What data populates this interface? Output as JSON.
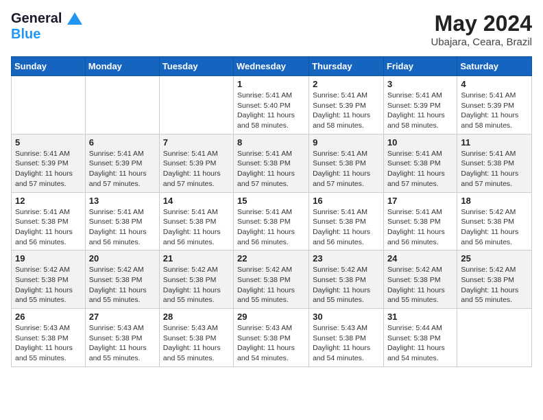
{
  "logo": {
    "line1": "General",
    "line2": "Blue"
  },
  "header": {
    "month_year": "May 2024",
    "location": "Ubajara, Ceara, Brazil"
  },
  "days_of_week": [
    "Sunday",
    "Monday",
    "Tuesday",
    "Wednesday",
    "Thursday",
    "Friday",
    "Saturday"
  ],
  "weeks": [
    [
      {
        "day": "",
        "info": ""
      },
      {
        "day": "",
        "info": ""
      },
      {
        "day": "",
        "info": ""
      },
      {
        "day": "1",
        "info": "Sunrise: 5:41 AM\nSunset: 5:40 PM\nDaylight: 11 hours and 58 minutes."
      },
      {
        "day": "2",
        "info": "Sunrise: 5:41 AM\nSunset: 5:39 PM\nDaylight: 11 hours and 58 minutes."
      },
      {
        "day": "3",
        "info": "Sunrise: 5:41 AM\nSunset: 5:39 PM\nDaylight: 11 hours and 58 minutes."
      },
      {
        "day": "4",
        "info": "Sunrise: 5:41 AM\nSunset: 5:39 PM\nDaylight: 11 hours and 58 minutes."
      }
    ],
    [
      {
        "day": "5",
        "info": "Sunrise: 5:41 AM\nSunset: 5:39 PM\nDaylight: 11 hours and 57 minutes."
      },
      {
        "day": "6",
        "info": "Sunrise: 5:41 AM\nSunset: 5:39 PM\nDaylight: 11 hours and 57 minutes."
      },
      {
        "day": "7",
        "info": "Sunrise: 5:41 AM\nSunset: 5:39 PM\nDaylight: 11 hours and 57 minutes."
      },
      {
        "day": "8",
        "info": "Sunrise: 5:41 AM\nSunset: 5:38 PM\nDaylight: 11 hours and 57 minutes."
      },
      {
        "day": "9",
        "info": "Sunrise: 5:41 AM\nSunset: 5:38 PM\nDaylight: 11 hours and 57 minutes."
      },
      {
        "day": "10",
        "info": "Sunrise: 5:41 AM\nSunset: 5:38 PM\nDaylight: 11 hours and 57 minutes."
      },
      {
        "day": "11",
        "info": "Sunrise: 5:41 AM\nSunset: 5:38 PM\nDaylight: 11 hours and 57 minutes."
      }
    ],
    [
      {
        "day": "12",
        "info": "Sunrise: 5:41 AM\nSunset: 5:38 PM\nDaylight: 11 hours and 56 minutes."
      },
      {
        "day": "13",
        "info": "Sunrise: 5:41 AM\nSunset: 5:38 PM\nDaylight: 11 hours and 56 minutes."
      },
      {
        "day": "14",
        "info": "Sunrise: 5:41 AM\nSunset: 5:38 PM\nDaylight: 11 hours and 56 minutes."
      },
      {
        "day": "15",
        "info": "Sunrise: 5:41 AM\nSunset: 5:38 PM\nDaylight: 11 hours and 56 minutes."
      },
      {
        "day": "16",
        "info": "Sunrise: 5:41 AM\nSunset: 5:38 PM\nDaylight: 11 hours and 56 minutes."
      },
      {
        "day": "17",
        "info": "Sunrise: 5:41 AM\nSunset: 5:38 PM\nDaylight: 11 hours and 56 minutes."
      },
      {
        "day": "18",
        "info": "Sunrise: 5:42 AM\nSunset: 5:38 PM\nDaylight: 11 hours and 56 minutes."
      }
    ],
    [
      {
        "day": "19",
        "info": "Sunrise: 5:42 AM\nSunset: 5:38 PM\nDaylight: 11 hours and 55 minutes."
      },
      {
        "day": "20",
        "info": "Sunrise: 5:42 AM\nSunset: 5:38 PM\nDaylight: 11 hours and 55 minutes."
      },
      {
        "day": "21",
        "info": "Sunrise: 5:42 AM\nSunset: 5:38 PM\nDaylight: 11 hours and 55 minutes."
      },
      {
        "day": "22",
        "info": "Sunrise: 5:42 AM\nSunset: 5:38 PM\nDaylight: 11 hours and 55 minutes."
      },
      {
        "day": "23",
        "info": "Sunrise: 5:42 AM\nSunset: 5:38 PM\nDaylight: 11 hours and 55 minutes."
      },
      {
        "day": "24",
        "info": "Sunrise: 5:42 AM\nSunset: 5:38 PM\nDaylight: 11 hours and 55 minutes."
      },
      {
        "day": "25",
        "info": "Sunrise: 5:42 AM\nSunset: 5:38 PM\nDaylight: 11 hours and 55 minutes."
      }
    ],
    [
      {
        "day": "26",
        "info": "Sunrise: 5:43 AM\nSunset: 5:38 PM\nDaylight: 11 hours and 55 minutes."
      },
      {
        "day": "27",
        "info": "Sunrise: 5:43 AM\nSunset: 5:38 PM\nDaylight: 11 hours and 55 minutes."
      },
      {
        "day": "28",
        "info": "Sunrise: 5:43 AM\nSunset: 5:38 PM\nDaylight: 11 hours and 55 minutes."
      },
      {
        "day": "29",
        "info": "Sunrise: 5:43 AM\nSunset: 5:38 PM\nDaylight: 11 hours and 54 minutes."
      },
      {
        "day": "30",
        "info": "Sunrise: 5:43 AM\nSunset: 5:38 PM\nDaylight: 11 hours and 54 minutes."
      },
      {
        "day": "31",
        "info": "Sunrise: 5:44 AM\nSunset: 5:38 PM\nDaylight: 11 hours and 54 minutes."
      },
      {
        "day": "",
        "info": ""
      }
    ]
  ]
}
